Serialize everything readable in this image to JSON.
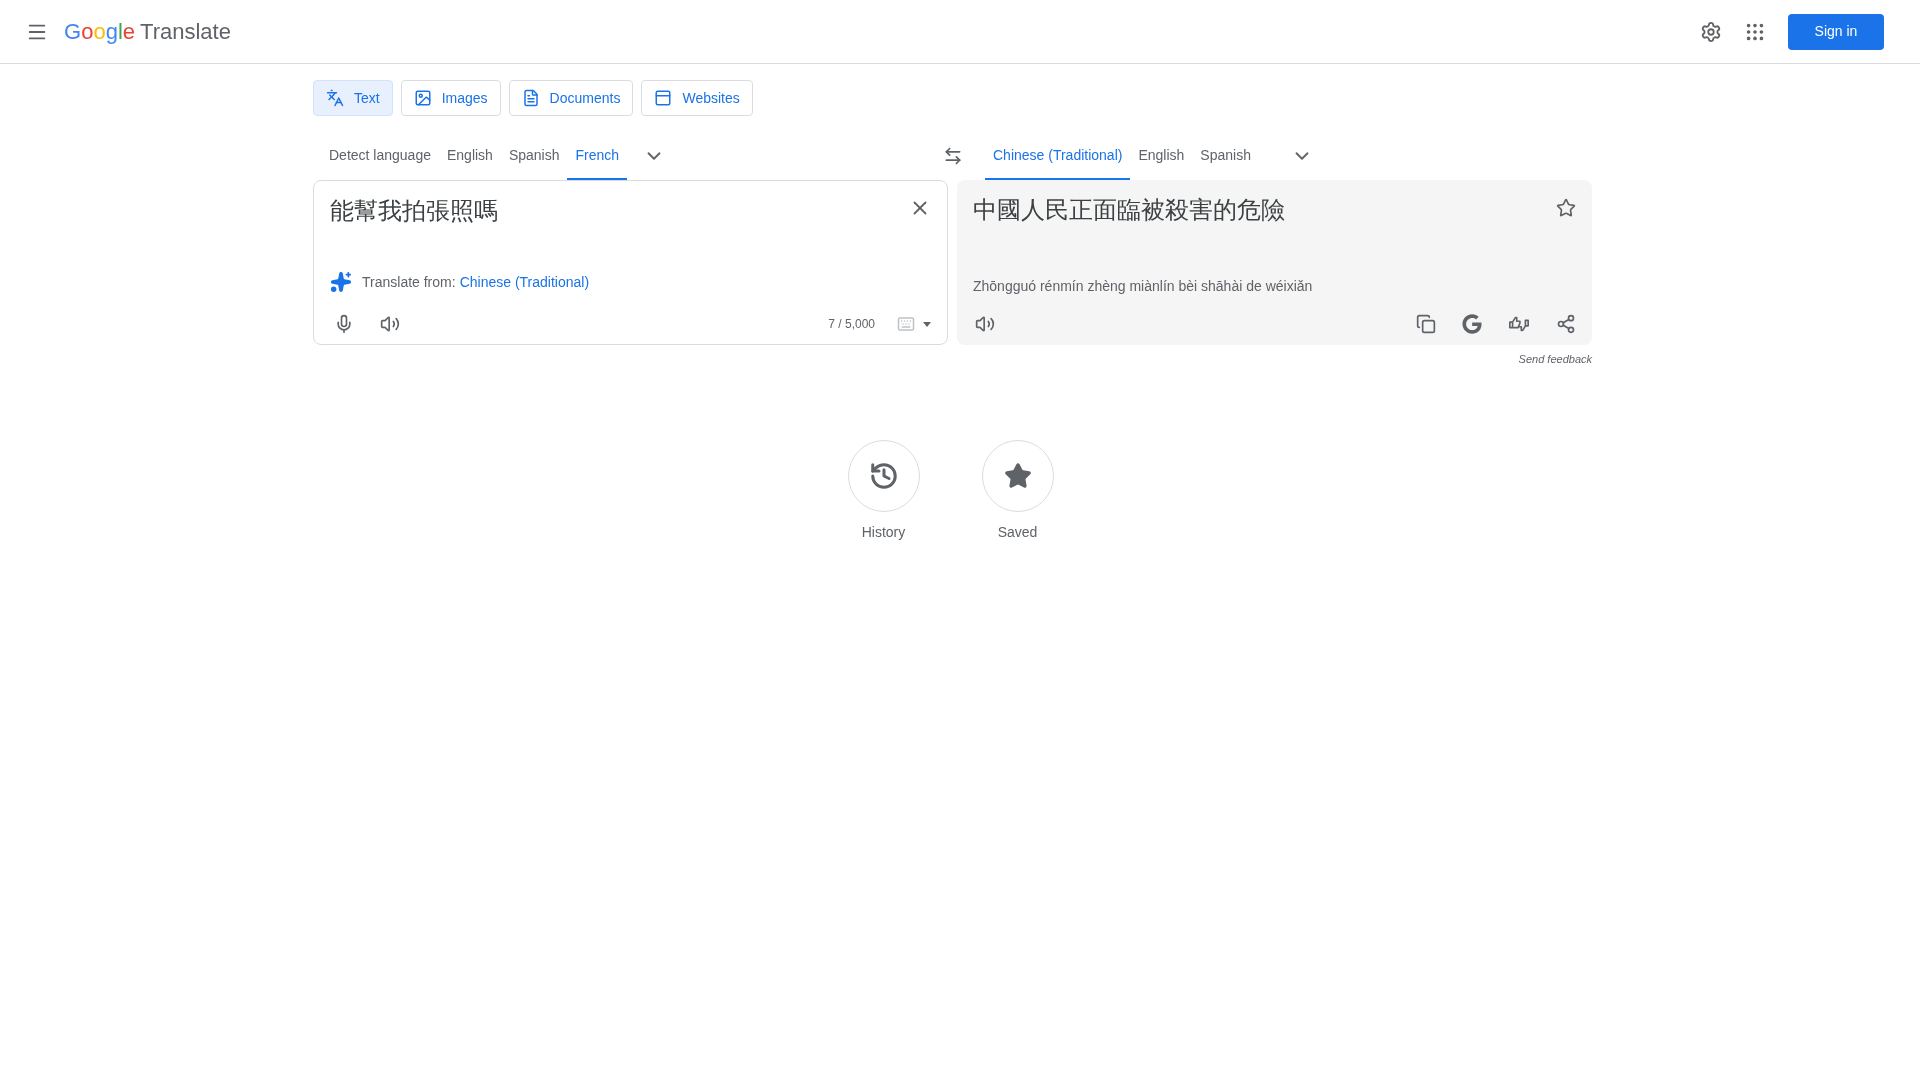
{
  "header": {
    "logo": {
      "brand": "Google",
      "product": "Translate"
    },
    "sign_in": "Sign in"
  },
  "modes": [
    {
      "label": "Text",
      "kind": "text",
      "selected": true
    },
    {
      "label": "Images",
      "kind": "images",
      "selected": false
    },
    {
      "label": "Documents",
      "kind": "documents",
      "selected": false
    },
    {
      "label": "Websites",
      "kind": "websites",
      "selected": false
    }
  ],
  "source_languages": [
    {
      "label": "Detect language",
      "selected": false
    },
    {
      "label": "English",
      "selected": false
    },
    {
      "label": "Spanish",
      "selected": false
    },
    {
      "label": "French",
      "selected": true
    }
  ],
  "target_languages": [
    {
      "label": "Chinese (Traditional)",
      "selected": true
    },
    {
      "label": "English",
      "selected": false
    },
    {
      "label": "Spanish",
      "selected": false
    }
  ],
  "source": {
    "value": "能幫我拍張照嗎",
    "hint_label": "Translate from:",
    "hint_link": "Chinese (Traditional)",
    "count": "7 / 5,000"
  },
  "target": {
    "text": "中國人民正面臨被殺害的危險",
    "romanization": "Zhōngguó rénmín zhèng miànlín bèi shāhài de wéixiǎn",
    "saved": false
  },
  "send_feedback": "Send feedback",
  "shortcuts": [
    {
      "label": "History",
      "kind": "history"
    },
    {
      "label": "Saved",
      "kind": "saved"
    }
  ]
}
